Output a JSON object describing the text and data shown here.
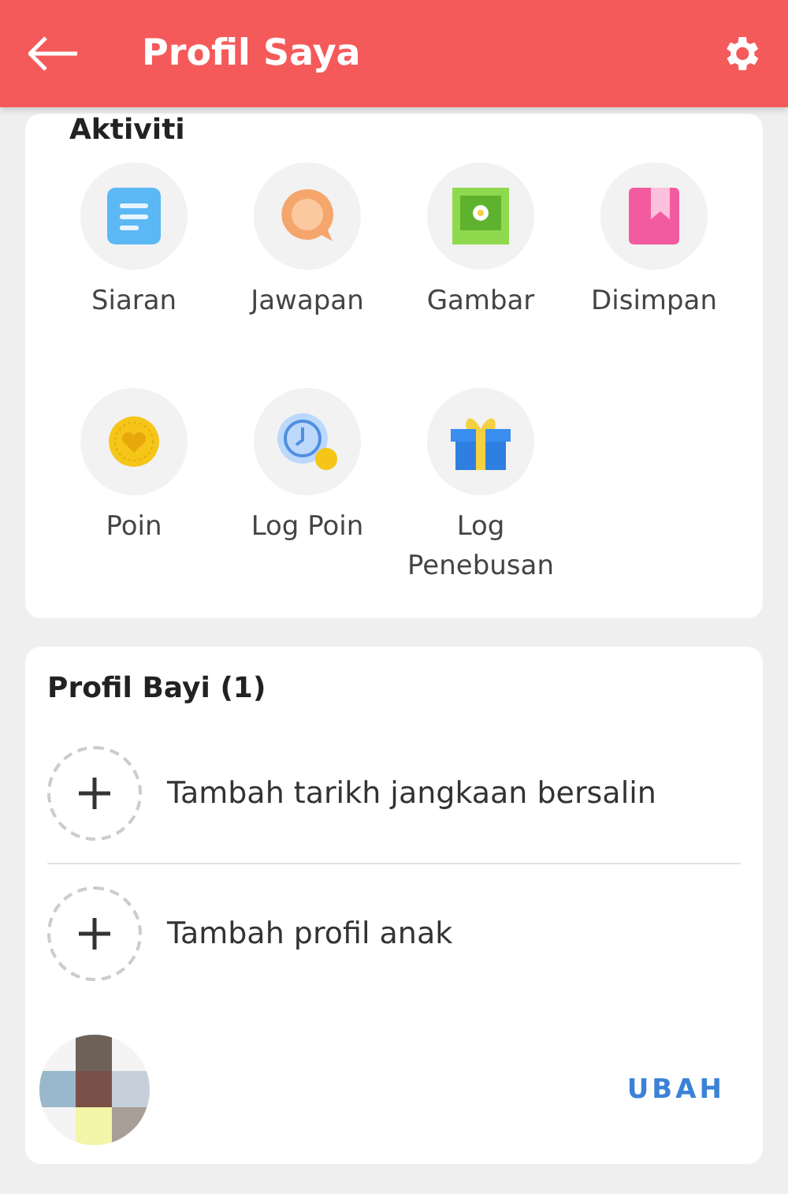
{
  "header": {
    "title": "Profil Saya"
  },
  "activity": {
    "title": "Aktiviti",
    "items": [
      {
        "label": "Siaran"
      },
      {
        "label": "Jawapan"
      },
      {
        "label": "Gambar"
      },
      {
        "label": "Disimpan"
      },
      {
        "label": "Poin"
      },
      {
        "label": "Log Poin"
      },
      {
        "label": "Log Penebusan"
      }
    ]
  },
  "baby_profile": {
    "title": "Profil Bayi (1)",
    "actions": [
      {
        "label": "Tambah tarikh jangkaan bersalin"
      },
      {
        "label": "Tambah profil anak"
      }
    ],
    "child": {
      "edit": "UBAH"
    }
  }
}
